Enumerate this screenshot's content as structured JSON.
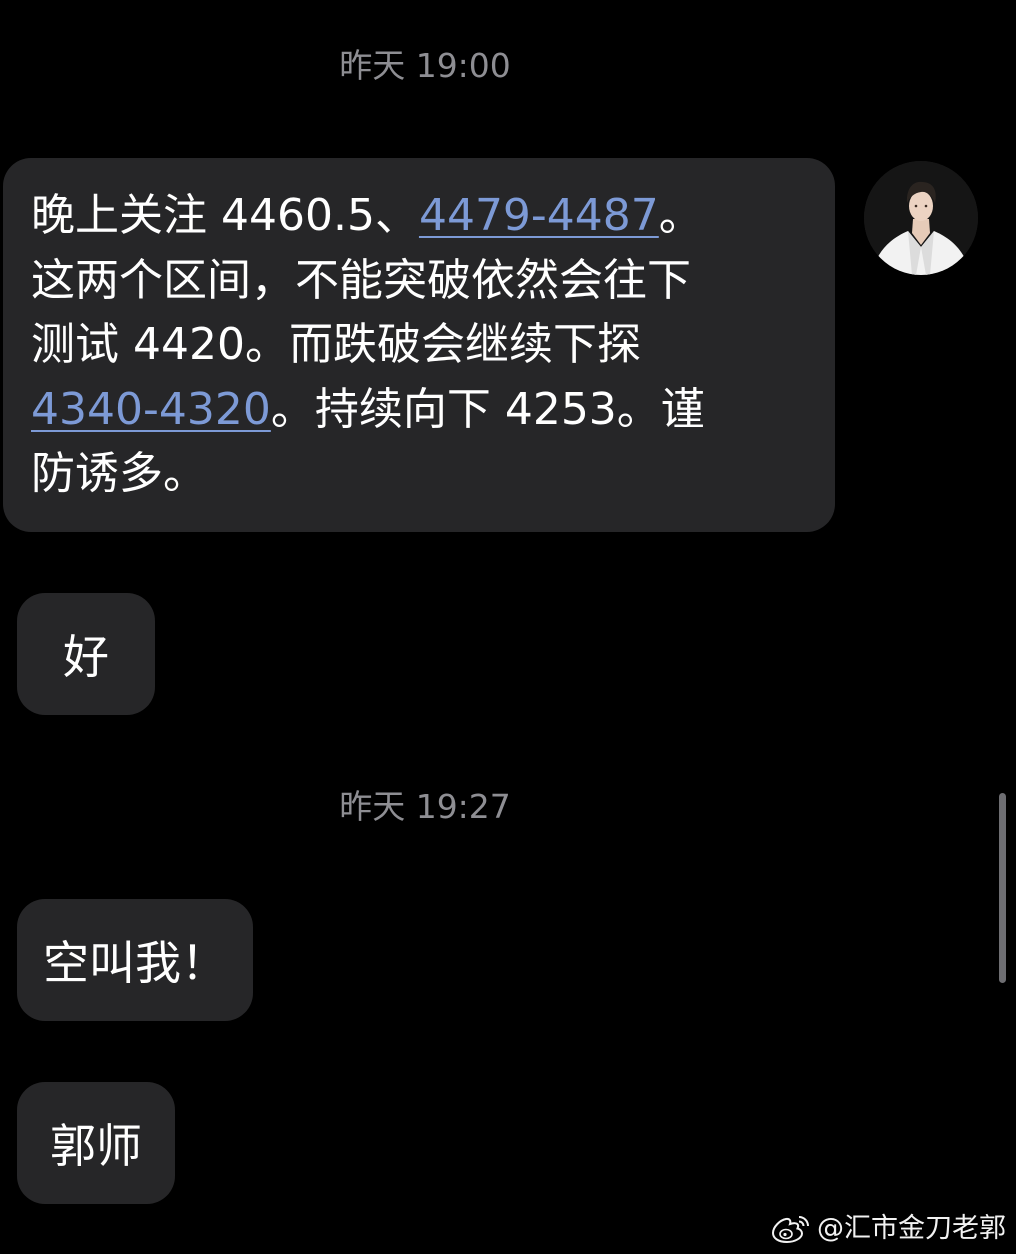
{
  "timestamps": {
    "first": "昨天 19:00",
    "second": "昨天 19:27"
  },
  "messages": {
    "main": {
      "line1_text": "晚上关注 4460.5、",
      "line1_link": "4479-4487",
      "line1_end": "。",
      "line2": "这两个区间，不能突破依然会往下",
      "line3": "测试 4420。而跌破会继续下探",
      "line4_link": "4340-4320",
      "line4_end": "。持续向下 4253。谨",
      "line5": "防诱多。"
    },
    "reply1": "好",
    "reply2": "空叫我！",
    "reply3": "郭师"
  },
  "watermark": {
    "text": "@汇市金刀老郭",
    "icon": "weibo-logo-icon"
  },
  "colors": {
    "background": "#000000",
    "bubble": "#262628",
    "link": "#7d9ad6",
    "timestamp": "#8e8e93"
  }
}
